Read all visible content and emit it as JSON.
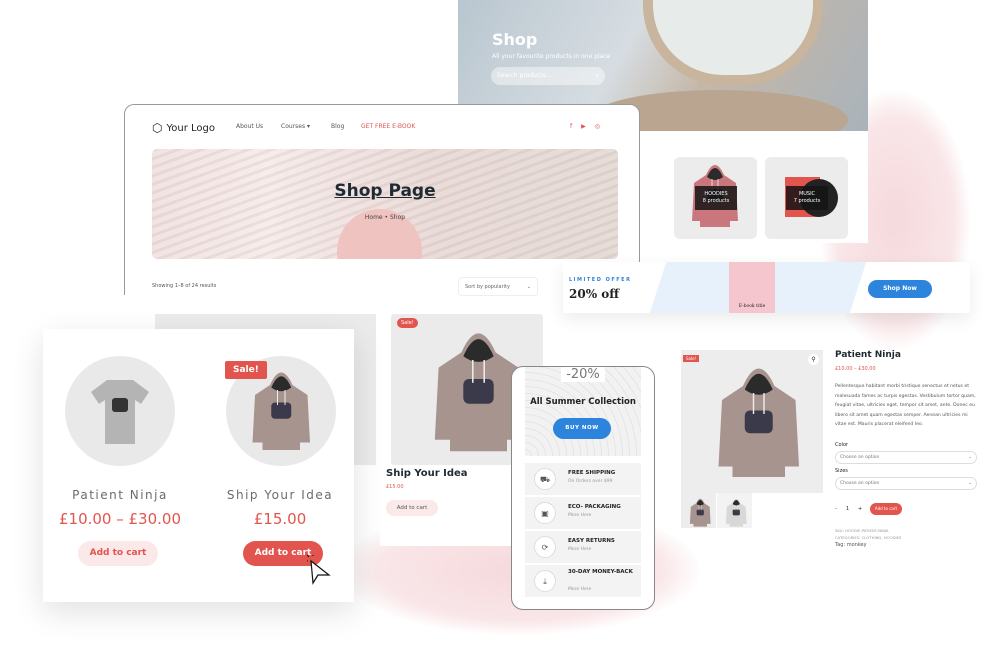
{
  "shop_hero": {
    "title": "Shop",
    "subtitle": "All your favourite products in one place",
    "search_placeholder": "Search products..."
  },
  "categories": [
    {
      "name": "HOODIES",
      "count": "8 products"
    },
    {
      "name": "MUSIC",
      "count": "7 products"
    }
  ],
  "promo": {
    "eyebrow": "LIMITED OFFER",
    "headline": "20% off",
    "ebook_title": "E-book title",
    "button": "Shop Now"
  },
  "browser": {
    "logo": "Your Logo",
    "nav": [
      "About Us",
      "Courses",
      "Blog",
      "GET FREE E-BOOK"
    ],
    "social_icons": [
      "facebook-icon",
      "youtube-icon",
      "instagram-icon"
    ],
    "page_title": "Shop Page",
    "breadcrumb": {
      "home": "Home",
      "sep": "•",
      "current": "Shop"
    },
    "result_count": "Showing 1–8 of 24 results",
    "sort": "Sort by popularity"
  },
  "mid_product": {
    "badge": "Sale!",
    "name": "Ship Your Idea",
    "price": "£15.00",
    "button": "Add to cart"
  },
  "front_products": [
    {
      "name": "Patient Ninja",
      "price": "£10.00 – £30.00",
      "button": "Add to cart"
    },
    {
      "badge": "Sale!",
      "name": "Ship Your Idea",
      "price": "£15.00",
      "button": "Add to cart"
    }
  ],
  "mobile": {
    "discount": "-20%",
    "title": "All Summer Collection",
    "button": "BUY NOW",
    "features": [
      {
        "icon": "truck-icon",
        "title": "FREE SHIPPING",
        "sub": "On Orders over $99"
      },
      {
        "icon": "package-icon",
        "title": "ECO- PACKAGING",
        "sub": "More Here"
      },
      {
        "icon": "refresh-icon",
        "title": "EASY RETURNS",
        "sub": "More Here"
      },
      {
        "icon": "money-back-icon",
        "title": "30-DAY MONEY-BACK",
        "sub": "More Here"
      }
    ]
  },
  "detail": {
    "badge": "Sale!",
    "title": "Patient Ninja",
    "price": "£10.00 – £30.00",
    "description": "Pellentesque habitant morbi tristique senectus et netus et malesuada fames ac turpis egestas. Vestibulum tortor quam, feugiat vitae, ultricies eget, tempor sit amet, ante. Donec eu libero sit amet quam egestas semper. Aenean ultricies mi vitae est. Mauris placerat eleifend leo.",
    "color_label": "Color",
    "sizes_label": "Sizes",
    "select_placeholder": "Choose an option",
    "qty": "1",
    "qty_minus": "-",
    "qty_plus": "+",
    "button": "Add to cart",
    "sku": "SKU: HOODIE-PATIENT-NINJA",
    "categories": "CATEGORIES: CLOTHING, HOODIES",
    "tag": "Tag: monkey"
  },
  "colors": {
    "accent": "#e2544e",
    "blue": "#2d84dd",
    "soft_pink": "#fbe9ea"
  }
}
